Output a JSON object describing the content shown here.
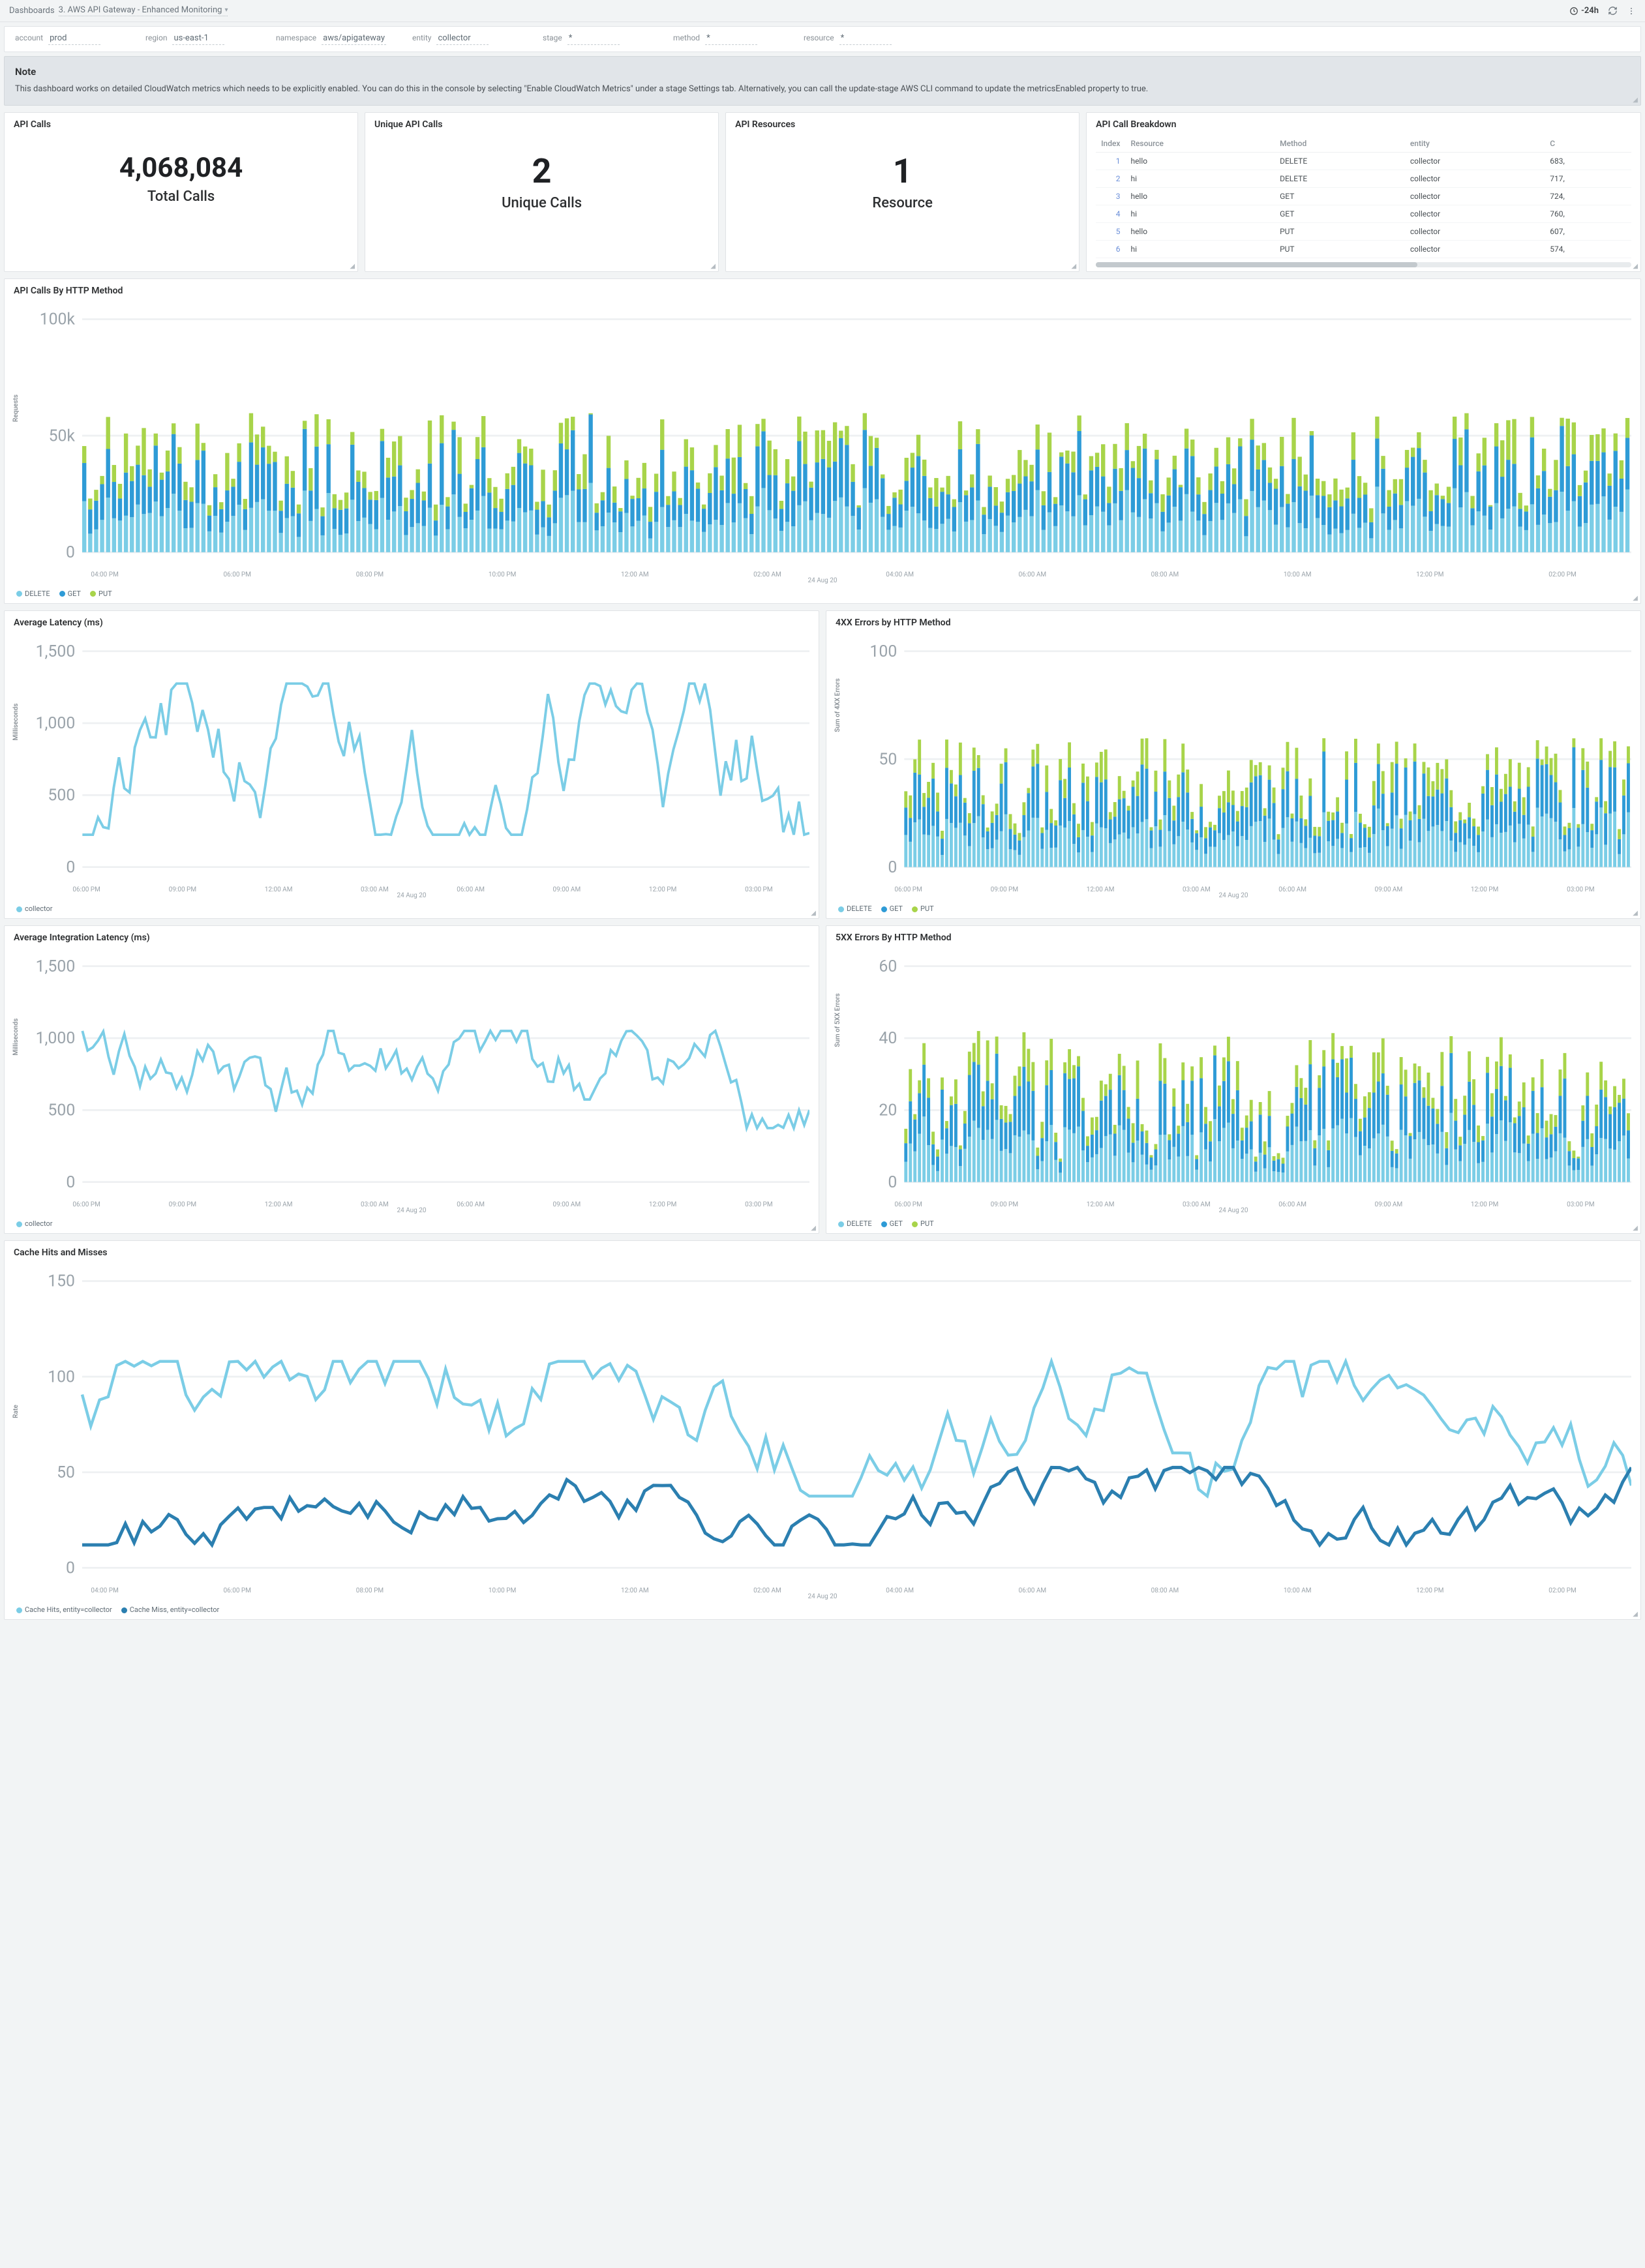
{
  "breadcrumb": {
    "root": "Dashboards",
    "title": "3. AWS API Gateway - Enhanced Monitoring"
  },
  "time_range": "-24h",
  "filters": [
    {
      "label": "account",
      "value": "prod"
    },
    {
      "label": "region",
      "value": "us-east-1"
    },
    {
      "label": "namespace",
      "value": "aws/apigateway"
    },
    {
      "label": "entity",
      "value": "collector"
    },
    {
      "label": "stage",
      "value": "*"
    },
    {
      "label": "method",
      "value": "*"
    },
    {
      "label": "resource",
      "value": "*"
    }
  ],
  "note": {
    "heading": "Note",
    "body": "This dashboard works on detailed CloudWatch metrics which needs to be explicitly enabled. You can do this in the console by selecting \"Enable CloudWatch Metrics\" under a stage Settings tab. Alternatively, you can call the update-stage AWS CLI command to update the metricsEnabled property to true."
  },
  "stats": {
    "api_calls": {
      "title": "API Calls",
      "value": "4,068,084",
      "label": "Total Calls"
    },
    "unique_calls": {
      "title": "Unique API Calls",
      "value": "2",
      "label": "Unique Calls"
    },
    "api_resources": {
      "title": "API Resources",
      "value": "1",
      "label": "Resource"
    }
  },
  "breakdown": {
    "title": "API Call Breakdown",
    "columns": [
      "Index",
      "Resource",
      "Method",
      "entity",
      "C"
    ],
    "rows": [
      {
        "idx": "1",
        "resource": "hello",
        "method": "DELETE",
        "entity": "collector",
        "c": "683,"
      },
      {
        "idx": "2",
        "resource": "hi",
        "method": "DELETE",
        "entity": "collector",
        "c": "717,"
      },
      {
        "idx": "3",
        "resource": "hello",
        "method": "GET",
        "entity": "collector",
        "c": "724,"
      },
      {
        "idx": "4",
        "resource": "hi",
        "method": "GET",
        "entity": "collector",
        "c": "760,"
      },
      {
        "idx": "5",
        "resource": "hello",
        "method": "PUT",
        "entity": "collector",
        "c": "607,"
      },
      {
        "idx": "6",
        "resource": "hi",
        "method": "PUT",
        "entity": "collector",
        "c": "574,"
      }
    ]
  },
  "charts": {
    "by_method": {
      "title": "API Calls By HTTP Method",
      "ylabel": "Requests",
      "yticks": [
        "100k",
        "50k",
        "0"
      ],
      "xdate": "24 Aug 20",
      "legend": [
        {
          "name": "DELETE",
          "color": "#7bcde6"
        },
        {
          "name": "GET",
          "color": "#2e9bd6"
        },
        {
          "name": "PUT",
          "color": "#a8d44a"
        }
      ]
    },
    "avg_latency": {
      "title": "Average Latency (ms)",
      "ylabel": "Milliseconds",
      "yticks": [
        "1,500",
        "1,000",
        "500",
        "0"
      ],
      "xdate": "24 Aug 20",
      "legend": [
        {
          "name": "collector",
          "color": "#7bcde6"
        }
      ]
    },
    "err4xx": {
      "title": "4XX Errors by HTTP Method",
      "ylabel": "Sum of 4XX Errors",
      "yticks": [
        "100",
        "50",
        "0"
      ],
      "xdate": "24 Aug 20",
      "legend": [
        {
          "name": "DELETE",
          "color": "#7bcde6"
        },
        {
          "name": "GET",
          "color": "#2e9bd6"
        },
        {
          "name": "PUT",
          "color": "#a8d44a"
        }
      ]
    },
    "avg_int_latency": {
      "title": "Average Integration Latency (ms)",
      "ylabel": "Milliseconds",
      "yticks": [
        "1,500",
        "1,000",
        "500",
        "0"
      ],
      "xdate": "24 Aug 20",
      "legend": [
        {
          "name": "collector",
          "color": "#7bcde6"
        }
      ]
    },
    "err5xx": {
      "title": "5XX Errors By HTTP Method",
      "ylabel": "Sum of 5XX Errors",
      "yticks": [
        "60",
        "40",
        "20",
        "0"
      ],
      "xdate": "24 Aug 20",
      "legend": [
        {
          "name": "DELETE",
          "color": "#7bcde6"
        },
        {
          "name": "GET",
          "color": "#2e9bd6"
        },
        {
          "name": "PUT",
          "color": "#a8d44a"
        }
      ]
    },
    "cache": {
      "title": "Cache Hits and Misses",
      "ylabel": "Rate",
      "yticks": [
        "150",
        "100",
        "50",
        "0"
      ],
      "xdate": "24 Aug 20",
      "legend": [
        {
          "name": "Cache Hits, entity=collector",
          "color": "#7bcde6"
        },
        {
          "name": "Cache Miss, entity=collector",
          "color": "#2b7fb0"
        }
      ]
    }
  },
  "xticks_wide": [
    "04:00 PM",
    "06:00 PM",
    "08:00 PM",
    "10:00 PM",
    "12:00 AM",
    "02:00 AM",
    "04:00 AM",
    "06:00 AM",
    "08:00 AM",
    "10:00 AM",
    "12:00 PM",
    "02:00 PM"
  ],
  "xticks_half": [
    "06:00 PM",
    "09:00 PM",
    "12:00 AM",
    "03:00 AM",
    "06:00 AM",
    "09:00 AM",
    "12:00 PM",
    "03:00 PM"
  ],
  "chart_data": [
    {
      "type": "bar",
      "title": "API Calls By HTTP Method (stacked)",
      "ylabel": "Requests",
      "ylim": [
        0,
        100000
      ],
      "note": "per-bucket totals approx 20k–70k split across DELETE/GET/PUT over 24h, ~280 5-min buckets",
      "series": [
        {
          "name": "DELETE"
        },
        {
          "name": "GET"
        },
        {
          "name": "PUT"
        }
      ]
    },
    {
      "type": "line",
      "title": "Average Latency (ms)",
      "ylabel": "Milliseconds",
      "ylim": [
        0,
        1500
      ],
      "series": [
        {
          "name": "collector",
          "approx_range": [
            200,
            1300
          ]
        }
      ]
    },
    {
      "type": "bar",
      "title": "4XX Errors by HTTP Method",
      "ylabel": "Sum of 4XX Errors",
      "ylim": [
        0,
        100
      ],
      "series": [
        {
          "name": "DELETE"
        },
        {
          "name": "GET"
        },
        {
          "name": "PUT"
        }
      ],
      "approx_range": [
        5,
        55
      ]
    },
    {
      "type": "line",
      "title": "Average Integration Latency (ms)",
      "ylabel": "Milliseconds",
      "ylim": [
        0,
        1500
      ],
      "series": [
        {
          "name": "collector",
          "approx_range": [
            300,
            1150
          ]
        }
      ]
    },
    {
      "type": "bar",
      "title": "5XX Errors By HTTP Method",
      "ylabel": "Sum of 5XX Errors",
      "ylim": [
        0,
        60
      ],
      "series": [
        {
          "name": "DELETE"
        },
        {
          "name": "GET"
        },
        {
          "name": "PUT"
        }
      ],
      "approx_range": [
        3,
        45
      ]
    },
    {
      "type": "line",
      "title": "Cache Hits and Misses",
      "ylabel": "Rate",
      "ylim": [
        0,
        150
      ],
      "series": [
        {
          "name": "Cache Hits",
          "approx_range": [
            30,
            105
          ]
        },
        {
          "name": "Cache Miss",
          "approx_range": [
            10,
            55
          ]
        }
      ]
    }
  ]
}
